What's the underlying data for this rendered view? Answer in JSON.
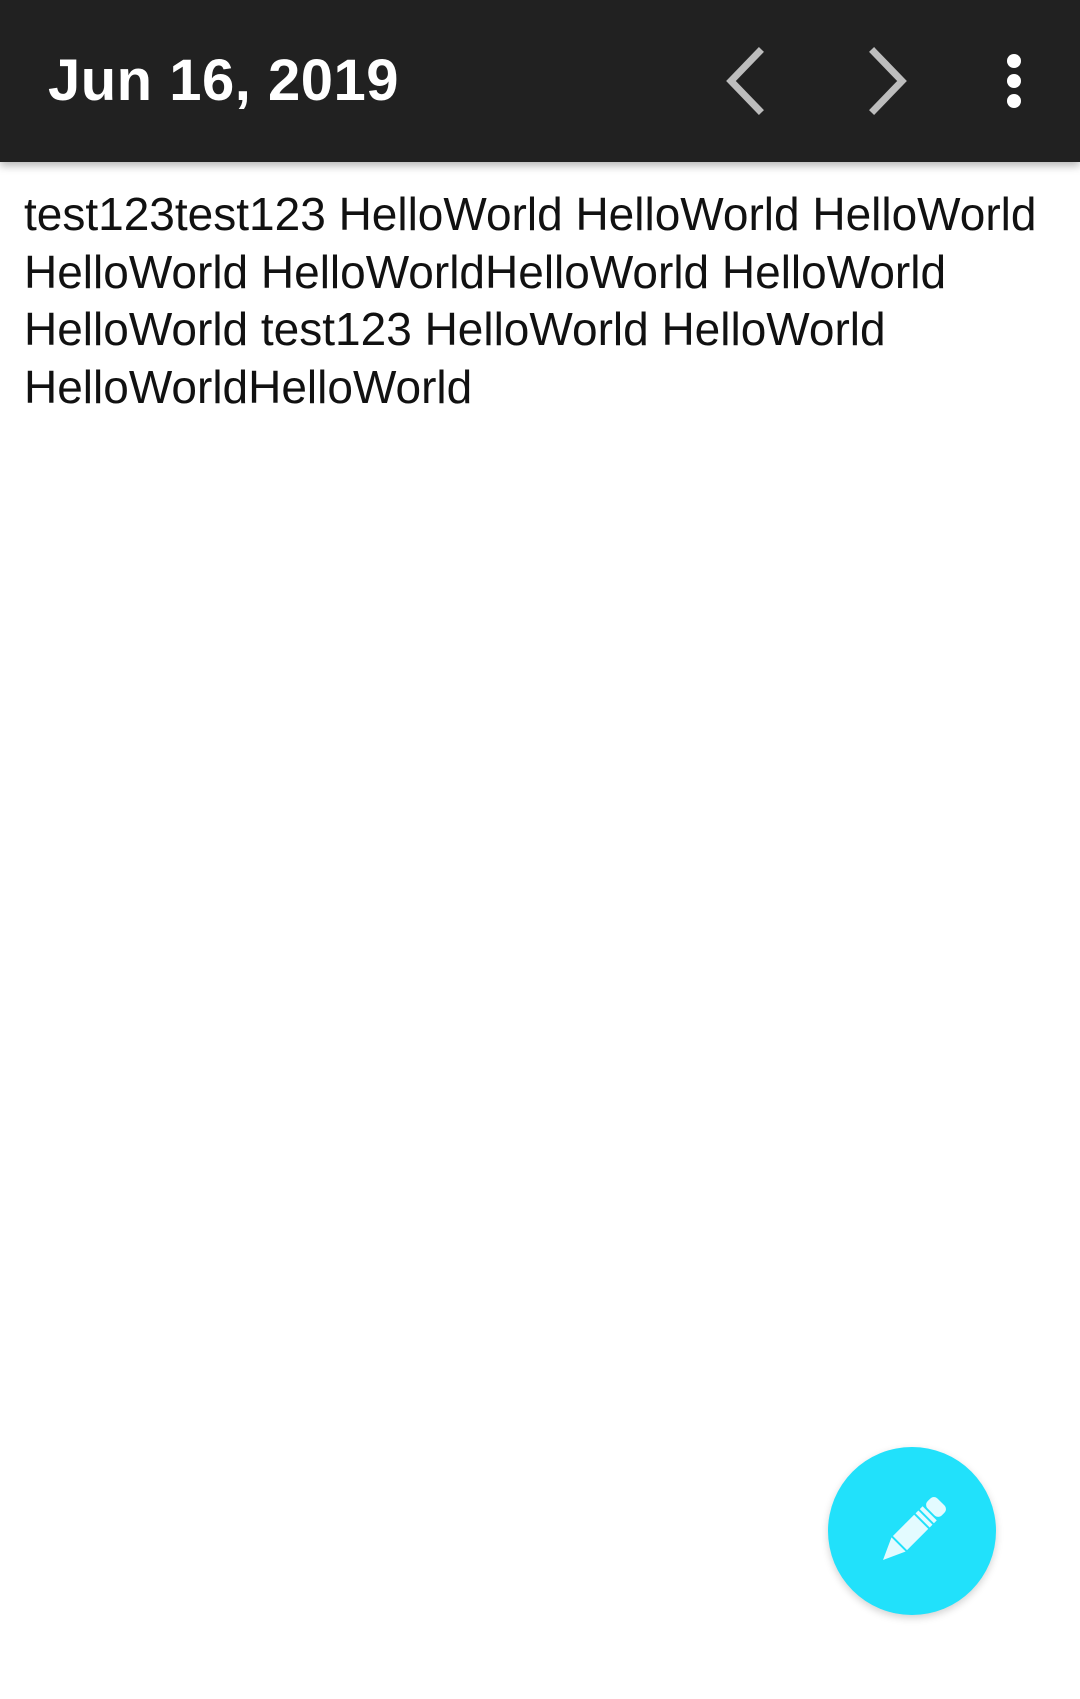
{
  "toolbar": {
    "title": "Jun 16, 2019",
    "prev_icon": "chevron-left-icon",
    "next_icon": "chevron-right-icon",
    "more_icon": "more-vert-icon",
    "background_color": "#212121"
  },
  "note": {
    "text": "test123test123 HelloWorld HelloWorld HelloWorld HelloWorld HelloWorldHelloWorld HelloWorld HelloWorld test123 HelloWorld HelloWorld HelloWorldHelloWorld"
  },
  "fab": {
    "icon": "pencil-icon",
    "color": "#21e1fb"
  }
}
